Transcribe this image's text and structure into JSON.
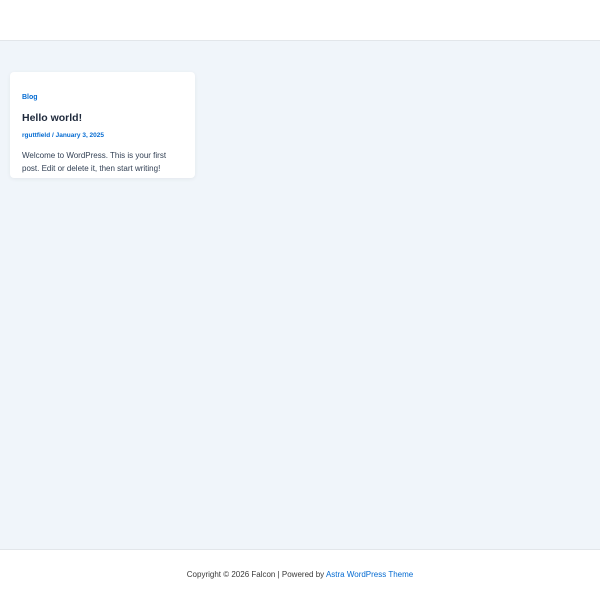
{
  "post": {
    "category": "Blog",
    "title": "Hello world!",
    "author": "rguttfield",
    "meta_separator": " / ",
    "date": "January 3, 2025",
    "excerpt": "Welcome to WordPress. This is your first post. Edit or delete it, then start writing!"
  },
  "footer": {
    "prefix": "Copyright © 2026 Falcon | Powered by ",
    "link_text": "Astra WordPress Theme"
  },
  "colors": {
    "accent": "#046bd2",
    "page_background": "#f0f5fa",
    "card_background": "#ffffff",
    "title": "#1e293b"
  }
}
